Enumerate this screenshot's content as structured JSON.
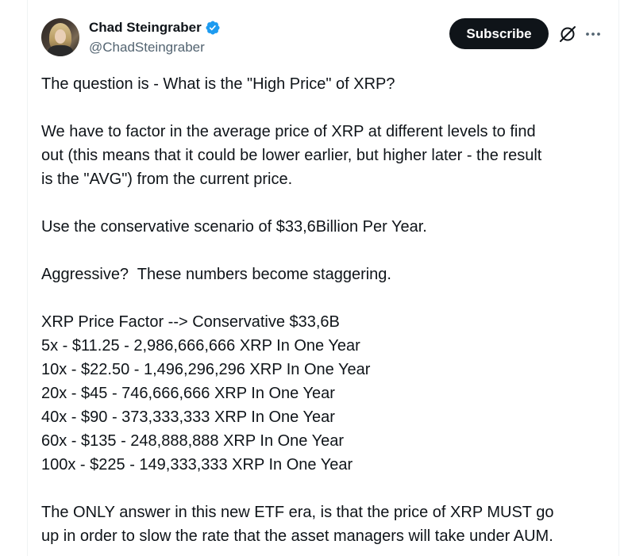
{
  "author": {
    "display_name": "Chad Steingraber",
    "handle": "@ChadSteingraber",
    "verified": true,
    "avatar_icon": "profile-photo"
  },
  "actions": {
    "subscribe_label": "Subscribe",
    "grok_icon": "grok-icon",
    "more_icon": "more-options-icon"
  },
  "colors": {
    "text_primary": "#0f1419",
    "text_secondary": "#536471",
    "verified_blue": "#1d9bf0",
    "button_bg": "#0f1419",
    "button_text": "#ffffff"
  },
  "tweet": {
    "lines": [
      "The question is - What is the \"High Price\" of XRP?",
      "",
      "We have to factor in the average price of XRP at different levels to find",
      "out (this means that it could be lower earlier, but higher later - the result",
      "is the \"AVG\") from the current price.",
      "",
      "Use the conservative scenario of $33,6Billion Per Year.",
      "",
      "Aggressive?  These numbers become staggering.",
      "",
      "XRP Price Factor --> Conservative $33,6B",
      "5x - $11.25 - 2,986,666,666 XRP In One Year",
      "10x - $22.50 - 1,496,296,296 XRP In One Year",
      "20x - $45 - 746,666,666 XRP In One Year",
      "40x - $90 - 373,333,333 XRP In One Year",
      "60x - $135 - 248,888,888 XRP In One Year",
      "100x - $225 - 149,333,333 XRP In One Year",
      "",
      "The ONLY answer in this new ETF era, is that the price of XRP MUST go",
      "up in order to slow the rate that the asset managers will take under AUM."
    ]
  }
}
